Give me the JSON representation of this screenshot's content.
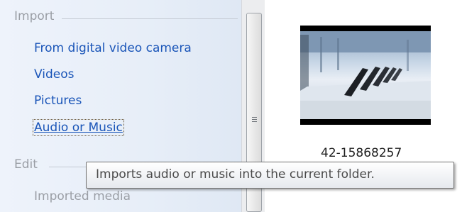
{
  "tasks_panel": {
    "import_section": {
      "header": "Import",
      "items": [
        "From digital video camera",
        "Videos",
        "Pictures",
        "Audio or Music"
      ]
    },
    "edit_section": {
      "header": "Edit",
      "items": [
        "Imported media"
      ]
    }
  },
  "collection": {
    "clip_label": "42-15868257"
  },
  "tooltip": {
    "text": "Imports audio or music into the current folder."
  }
}
